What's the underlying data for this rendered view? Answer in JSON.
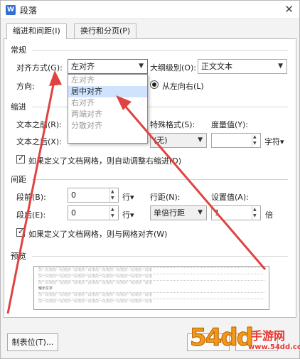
{
  "window": {
    "title": "段落",
    "app_icon": "W"
  },
  "tabs": [
    {
      "label": "缩进和间距(I)"
    },
    {
      "label": "换行和分页(P)"
    }
  ],
  "general": {
    "section": "常规",
    "alignment_label": "对齐方式(G):",
    "alignment_value": "左对齐",
    "outline_label": "大纲级别(O):",
    "outline_value": "正文文本",
    "direction_label": "方向:",
    "direction_option": "从左向右(L)"
  },
  "alignment_options": [
    {
      "label": "左对齐"
    },
    {
      "label": "居中对齐"
    },
    {
      "label": "右对齐"
    },
    {
      "label": "两端对齐"
    },
    {
      "label": "分散对齐"
    }
  ],
  "indent": {
    "section": "缩进",
    "left_label": "文本之前(R):",
    "right_label": "文本之后(X):",
    "special_label": "特殊格式(S):",
    "special_value": "(无)",
    "measure_label": "度量值(Y):",
    "measure_value": "",
    "measure_unit": "字符",
    "grid_check_label": "如果定义了文档网格，则自动调整右缩进(D)"
  },
  "spacing": {
    "section": "间距",
    "before_label": "段前(B):",
    "before_value": "0",
    "before_unit": "行",
    "after_label": "段后(E):",
    "after_value": "0",
    "after_unit": "行",
    "line_label": "行距(N):",
    "line_value": "单倍行距",
    "setting_label": "设置值(A):",
    "setting_value": "1",
    "setting_unit": "倍",
    "grid_check_label": "如果定义了文档网格，则与网格对齐(W)"
  },
  "preview": {
    "section": "预览",
    "filler": "前一段落前一段落前一段落前一段落前一段落前一段落前一段落前一段落",
    "sample": "矮示文字"
  },
  "buttons": {
    "tabs_button": "制表位(T)..."
  },
  "watermark": {
    "number": "54dd",
    "site_cn": "手游网",
    "site_url": "www.54dd.com"
  },
  "colors": {
    "annotation_red": "#e0433f",
    "selection_blue": "#cfe3ff",
    "focus_border": "#3b78d8"
  }
}
